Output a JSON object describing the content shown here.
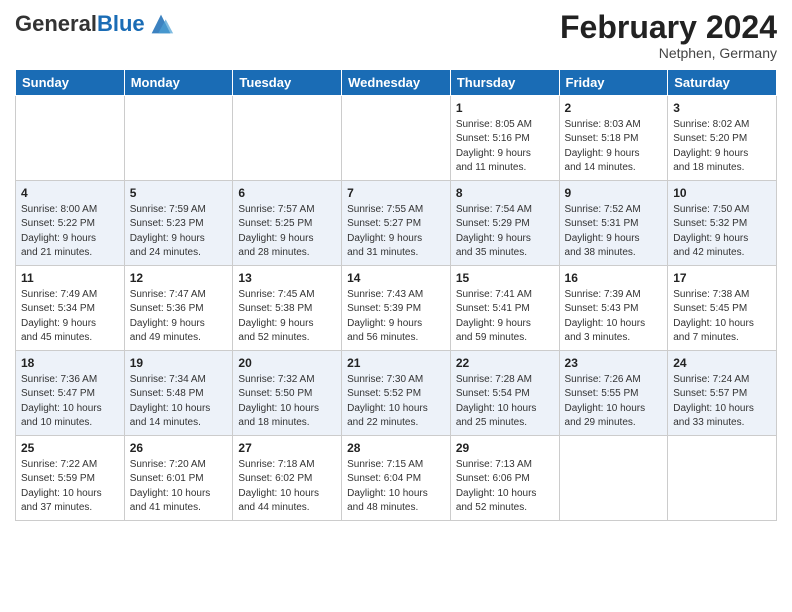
{
  "header": {
    "logo_general": "General",
    "logo_blue": "Blue",
    "month_title": "February 2024",
    "subtitle": "Netphen, Germany"
  },
  "days_of_week": [
    "Sunday",
    "Monday",
    "Tuesday",
    "Wednesday",
    "Thursday",
    "Friday",
    "Saturday"
  ],
  "weeks": [
    [
      {
        "day": "",
        "info": ""
      },
      {
        "day": "",
        "info": ""
      },
      {
        "day": "",
        "info": ""
      },
      {
        "day": "",
        "info": ""
      },
      {
        "day": "1",
        "info": "Sunrise: 8:05 AM\nSunset: 5:16 PM\nDaylight: 9 hours\nand 11 minutes."
      },
      {
        "day": "2",
        "info": "Sunrise: 8:03 AM\nSunset: 5:18 PM\nDaylight: 9 hours\nand 14 minutes."
      },
      {
        "day": "3",
        "info": "Sunrise: 8:02 AM\nSunset: 5:20 PM\nDaylight: 9 hours\nand 18 minutes."
      }
    ],
    [
      {
        "day": "4",
        "info": "Sunrise: 8:00 AM\nSunset: 5:22 PM\nDaylight: 9 hours\nand 21 minutes."
      },
      {
        "day": "5",
        "info": "Sunrise: 7:59 AM\nSunset: 5:23 PM\nDaylight: 9 hours\nand 24 minutes."
      },
      {
        "day": "6",
        "info": "Sunrise: 7:57 AM\nSunset: 5:25 PM\nDaylight: 9 hours\nand 28 minutes."
      },
      {
        "day": "7",
        "info": "Sunrise: 7:55 AM\nSunset: 5:27 PM\nDaylight: 9 hours\nand 31 minutes."
      },
      {
        "day": "8",
        "info": "Sunrise: 7:54 AM\nSunset: 5:29 PM\nDaylight: 9 hours\nand 35 minutes."
      },
      {
        "day": "9",
        "info": "Sunrise: 7:52 AM\nSunset: 5:31 PM\nDaylight: 9 hours\nand 38 minutes."
      },
      {
        "day": "10",
        "info": "Sunrise: 7:50 AM\nSunset: 5:32 PM\nDaylight: 9 hours\nand 42 minutes."
      }
    ],
    [
      {
        "day": "11",
        "info": "Sunrise: 7:49 AM\nSunset: 5:34 PM\nDaylight: 9 hours\nand 45 minutes."
      },
      {
        "day": "12",
        "info": "Sunrise: 7:47 AM\nSunset: 5:36 PM\nDaylight: 9 hours\nand 49 minutes."
      },
      {
        "day": "13",
        "info": "Sunrise: 7:45 AM\nSunset: 5:38 PM\nDaylight: 9 hours\nand 52 minutes."
      },
      {
        "day": "14",
        "info": "Sunrise: 7:43 AM\nSunset: 5:39 PM\nDaylight: 9 hours\nand 56 minutes."
      },
      {
        "day": "15",
        "info": "Sunrise: 7:41 AM\nSunset: 5:41 PM\nDaylight: 9 hours\nand 59 minutes."
      },
      {
        "day": "16",
        "info": "Sunrise: 7:39 AM\nSunset: 5:43 PM\nDaylight: 10 hours\nand 3 minutes."
      },
      {
        "day": "17",
        "info": "Sunrise: 7:38 AM\nSunset: 5:45 PM\nDaylight: 10 hours\nand 7 minutes."
      }
    ],
    [
      {
        "day": "18",
        "info": "Sunrise: 7:36 AM\nSunset: 5:47 PM\nDaylight: 10 hours\nand 10 minutes."
      },
      {
        "day": "19",
        "info": "Sunrise: 7:34 AM\nSunset: 5:48 PM\nDaylight: 10 hours\nand 14 minutes."
      },
      {
        "day": "20",
        "info": "Sunrise: 7:32 AM\nSunset: 5:50 PM\nDaylight: 10 hours\nand 18 minutes."
      },
      {
        "day": "21",
        "info": "Sunrise: 7:30 AM\nSunset: 5:52 PM\nDaylight: 10 hours\nand 22 minutes."
      },
      {
        "day": "22",
        "info": "Sunrise: 7:28 AM\nSunset: 5:54 PM\nDaylight: 10 hours\nand 25 minutes."
      },
      {
        "day": "23",
        "info": "Sunrise: 7:26 AM\nSunset: 5:55 PM\nDaylight: 10 hours\nand 29 minutes."
      },
      {
        "day": "24",
        "info": "Sunrise: 7:24 AM\nSunset: 5:57 PM\nDaylight: 10 hours\nand 33 minutes."
      }
    ],
    [
      {
        "day": "25",
        "info": "Sunrise: 7:22 AM\nSunset: 5:59 PM\nDaylight: 10 hours\nand 37 minutes."
      },
      {
        "day": "26",
        "info": "Sunrise: 7:20 AM\nSunset: 6:01 PM\nDaylight: 10 hours\nand 41 minutes."
      },
      {
        "day": "27",
        "info": "Sunrise: 7:18 AM\nSunset: 6:02 PM\nDaylight: 10 hours\nand 44 minutes."
      },
      {
        "day": "28",
        "info": "Sunrise: 7:15 AM\nSunset: 6:04 PM\nDaylight: 10 hours\nand 48 minutes."
      },
      {
        "day": "29",
        "info": "Sunrise: 7:13 AM\nSunset: 6:06 PM\nDaylight: 10 hours\nand 52 minutes."
      },
      {
        "day": "",
        "info": ""
      },
      {
        "day": "",
        "info": ""
      }
    ]
  ]
}
